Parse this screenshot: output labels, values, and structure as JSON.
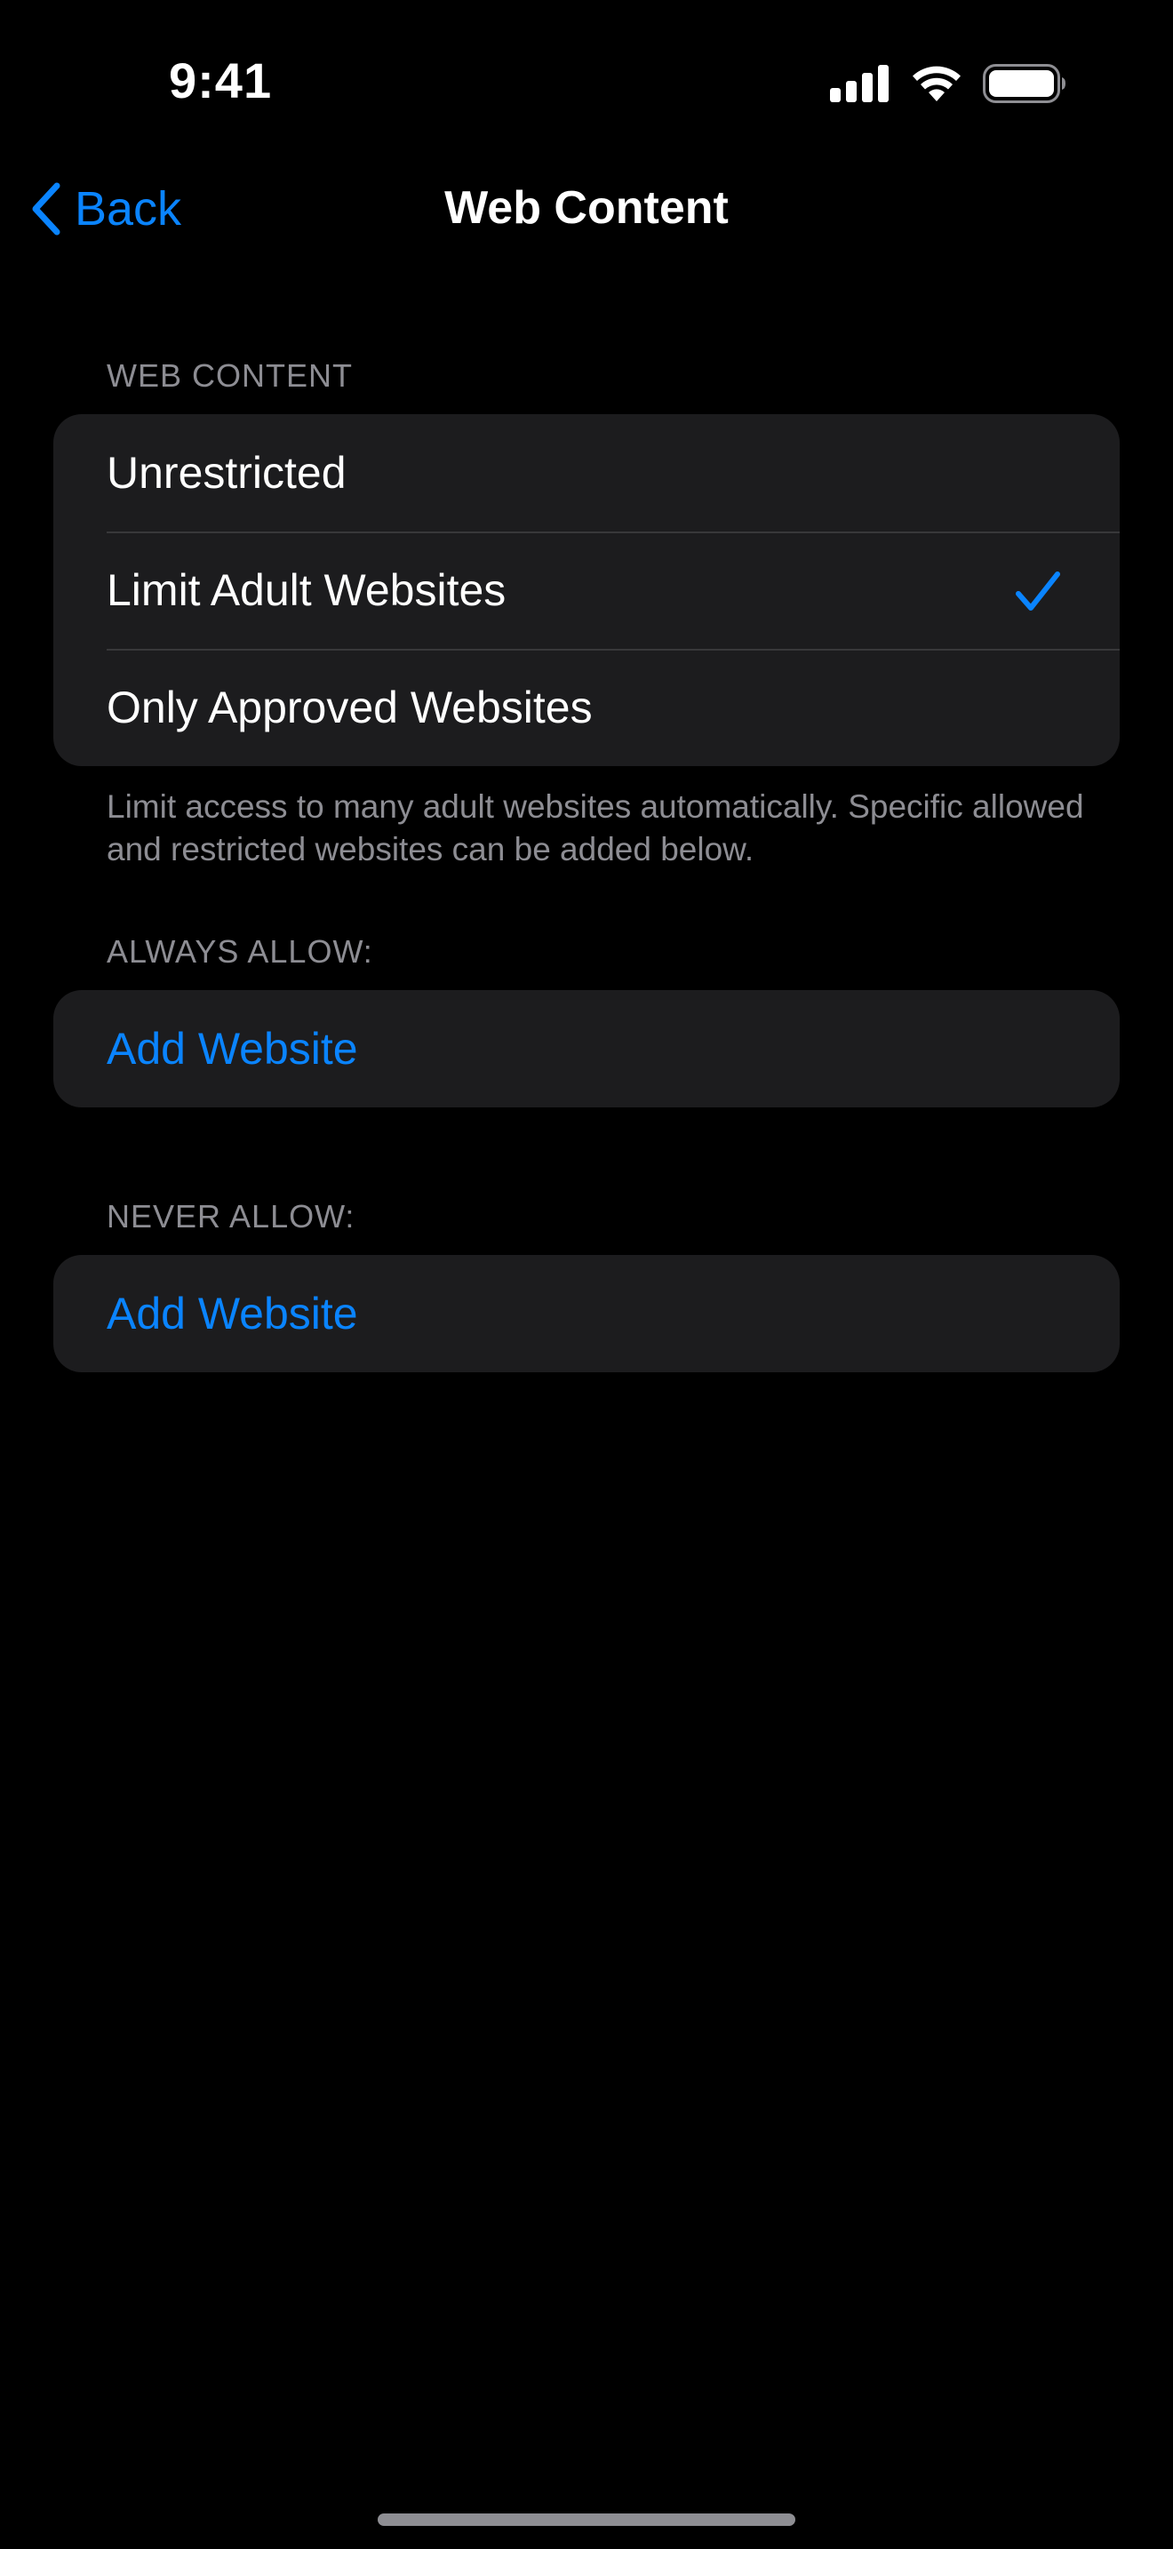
{
  "status_bar": {
    "time": "9:41"
  },
  "nav": {
    "back_label": "Back",
    "title": "Web Content"
  },
  "web_content_section": {
    "header": "WEB CONTENT",
    "options": [
      {
        "label": "Unrestricted",
        "selected": false
      },
      {
        "label": "Limit Adult Websites",
        "selected": true
      },
      {
        "label": "Only Approved Websites",
        "selected": false
      }
    ],
    "footer": "Limit access to many adult websites automatically. Specific allowed and restricted websites can be added below."
  },
  "always_allow_section": {
    "header": "ALWAYS ALLOW:",
    "add_label": "Add Website"
  },
  "never_allow_section": {
    "header": "NEVER ALLOW:",
    "add_label": "Add Website"
  },
  "colors": {
    "background": "#000000",
    "card": "#1c1c1e",
    "accent": "#0a84ff",
    "secondary_text": "#8d8d93"
  },
  "icons": [
    "signal-icon",
    "wifi-icon",
    "battery-icon",
    "chevron-left-icon",
    "checkmark-icon"
  ]
}
